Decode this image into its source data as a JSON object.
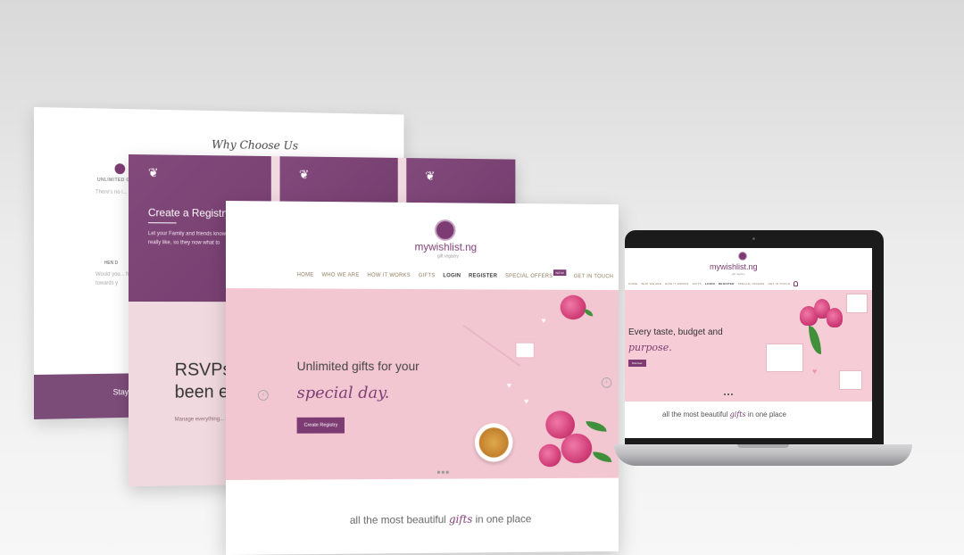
{
  "back_page": {
    "section_title": "Why Choose Us",
    "feature1_title": "UNLIMITED G",
    "feature1_text": "There's no l... much befo... in place in",
    "feature2_title": "HEN D",
    "feature2_text": "Would you... fuss? Add... guests can... towards y",
    "bar_text": "Stay"
  },
  "middle_page": {
    "card1_title": "Create a Registry",
    "card1_text": "Let your Family and friends know what you'd really like, so they now what to",
    "rsvp_line1": "RSVPs",
    "rsvp_line2": "been e",
    "manage_text": "Manage everything... receive real-time R"
  },
  "site": {
    "brand": "mywishlist.ng",
    "tagline": "gift registry",
    "nav": {
      "home": "HOME",
      "who": "WHO WE ARE",
      "how": "HOW IT WORKS",
      "gifts": "GIFTS",
      "login": "LOGIN",
      "register": "REGISTER",
      "offers": "SPECIAL OFFERS",
      "offers_badge": "NEW",
      "contact": "GET IN TOUCH"
    },
    "footer_pre": "all the most beautiful",
    "footer_gifts": "gifts",
    "footer_post": "in one place"
  },
  "front_hero": {
    "headline": "Unlimited gifts for your",
    "headline_script": "special day.",
    "cta": "Create Registry",
    "prev_arrow": "‹",
    "next_arrow": "›"
  },
  "laptop_hero": {
    "headline": "Every taste, budget and",
    "headline_script": "purpose.",
    "cta": "Discover"
  },
  "colors": {
    "brand_purple": "#7c3c73",
    "hero_pink": "#f3c7d2"
  }
}
